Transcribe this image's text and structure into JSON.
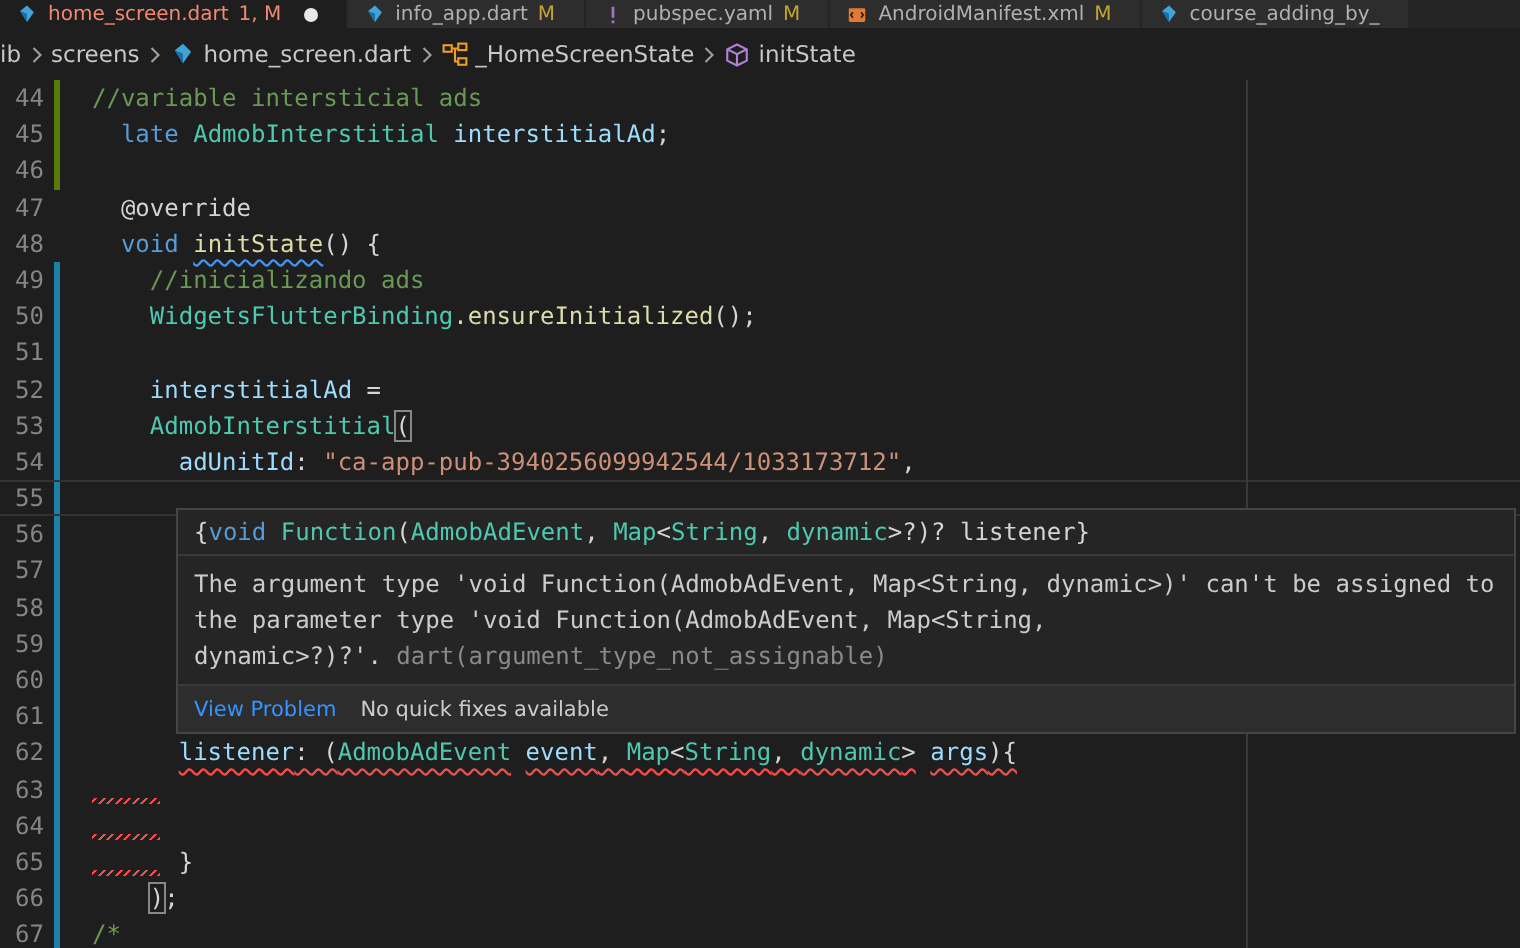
{
  "tabs": [
    {
      "label": "home_screen.dart",
      "badge": "1, M",
      "kind": "dart",
      "selected": true,
      "dirty": true
    },
    {
      "label": "info_app.dart",
      "badge": "M",
      "kind": "dart",
      "selected": false,
      "dirty": false
    },
    {
      "label": "pubspec.yaml",
      "badge": "M",
      "kind": "yaml",
      "selected": false,
      "dirty": false
    },
    {
      "label": "AndroidManifest.xml",
      "badge": "M",
      "kind": "xml",
      "selected": false,
      "dirty": false
    },
    {
      "label": "course_adding_by_",
      "kind": "dart",
      "selected": false,
      "dirty": false
    }
  ],
  "breadcrumb": [
    {
      "label": "ib",
      "kind": "folder"
    },
    {
      "label": "screens",
      "kind": "folder"
    },
    {
      "label": "home_screen.dart",
      "kind": "dart"
    },
    {
      "label": "_HomeScreenState",
      "kind": "class"
    },
    {
      "label": "initState",
      "kind": "method"
    }
  ],
  "lines": [
    {
      "number": "44",
      "kind": "added",
      "tokens": [
        {
          "kind": "comment",
          "text": "//variable intersticial ads"
        }
      ]
    },
    {
      "number": "45",
      "kind": "added",
      "tokens": [
        {
          "kind": "keyword",
          "text": "  late"
        },
        {
          "kind": "type",
          "text": " AdmobInterstitial"
        },
        {
          "kind": "variable",
          "text": " interstitialAd"
        },
        {
          "kind": "plain",
          "text": ";"
        }
      ]
    },
    {
      "number": "46",
      "kind": "added"
    },
    {
      "number": "47",
      "kind": "plain",
      "tokens": [
        {
          "kind": "plain",
          "text": "  @override"
        }
      ]
    },
    {
      "number": "48",
      "kind": "plain",
      "tokens": [
        {
          "kind": "keyword",
          "text": "  void"
        },
        {
          "kind": "function",
          "text": " initState",
          "warning": true
        },
        {
          "kind": "plain",
          "text": "() {"
        }
      ]
    },
    {
      "number": "49",
      "kind": "modified",
      "tokens": [
        {
          "kind": "comment",
          "text": "    //inicializando ads"
        }
      ]
    },
    {
      "number": "50",
      "kind": "modified",
      "tokens": [
        {
          "kind": "type",
          "text": "    WidgetsFlutterBinding"
        },
        {
          "kind": "function",
          "text": ".ensureInitialized"
        },
        {
          "kind": "plain",
          "text": "();"
        }
      ]
    },
    {
      "number": "51",
      "kind": "modified"
    },
    {
      "number": "52",
      "kind": "modified",
      "tokens": [
        {
          "kind": "variable",
          "text": "    interstitialAd"
        },
        {
          "kind": "plain",
          "text": " ="
        }
      ]
    },
    {
      "number": "53",
      "kind": "modified",
      "tokens": [
        {
          "kind": "type",
          "text": "    AdmobInterstitial"
        },
        {
          "kind": "plain",
          "text": "(",
          "bracket_match": true
        }
      ]
    },
    {
      "number": "54",
      "kind": "modified",
      "tokens": [
        {
          "kind": "variable",
          "text": "      adUnitId"
        },
        {
          "kind": "plain",
          "text": ": "
        },
        {
          "kind": "string",
          "text": "\"ca-app-pub-3940256099942544/1033173712\""
        },
        {
          "kind": "plain",
          "text": ","
        }
      ]
    },
    {
      "number": "55",
      "kind": "modified",
      "current": true
    },
    {
      "number": "56",
      "kind": "modified"
    },
    {
      "number": "57",
      "kind": "modified"
    },
    {
      "number": "58",
      "kind": "modified"
    },
    {
      "number": "59",
      "kind": "modified"
    },
    {
      "number": "60",
      "kind": "modified"
    },
    {
      "number": "61",
      "kind": "modified"
    },
    {
      "number": "62",
      "kind": "modified",
      "tokens": [
        {
          "kind": "variable",
          "text": "      listener",
          "error": true
        },
        {
          "kind": "plain",
          "text": ": (",
          "error": true
        },
        {
          "kind": "type",
          "text": "AdmobAdEvent",
          "error": true
        },
        {
          "kind": "variable",
          "text": " event",
          "error": true
        },
        {
          "kind": "plain",
          "text": ", ",
          "error": true
        },
        {
          "kind": "type",
          "text": "Map",
          "error": true
        },
        {
          "kind": "plain",
          "text": "<",
          "error": true
        },
        {
          "kind": "type",
          "text": "String",
          "error": true
        },
        {
          "kind": "plain",
          "text": ", ",
          "error": true
        },
        {
          "kind": "type",
          "text": "dynamic",
          "error": true
        },
        {
          "kind": "plain",
          "text": ">",
          "error": true
        },
        {
          "kind": "variable",
          "text": " args",
          "error": true
        },
        {
          "kind": "plain",
          "text": "){",
          "error": true
        }
      ]
    },
    {
      "number": "63",
      "kind": "modified",
      "gutter_error": true
    },
    {
      "number": "64",
      "kind": "modified",
      "gutter_error": true
    },
    {
      "number": "65",
      "kind": "modified",
      "gutter_error": true,
      "tokens": [
        {
          "kind": "plain",
          "text": "      }"
        }
      ]
    },
    {
      "number": "66",
      "kind": "modified",
      "tokens": [
        {
          "kind": "plain",
          "text": "    )",
          "bracket_match": true
        },
        {
          "kind": "plain",
          "text": ";"
        }
      ]
    },
    {
      "number": "67",
      "kind": "modified",
      "tokens": [
        {
          "kind": "comment",
          "text": "/*"
        }
      ]
    }
  ],
  "hover": {
    "signature": [
      {
        "kind": "plain",
        "text": "{"
      },
      {
        "kind": "keyword",
        "text": "void"
      },
      {
        "kind": "type",
        "text": " Function"
      },
      {
        "kind": "plain",
        "text": "("
      },
      {
        "kind": "type",
        "text": "AdmobAdEvent"
      },
      {
        "kind": "plain",
        "text": ", "
      },
      {
        "kind": "type",
        "text": "Map"
      },
      {
        "kind": "plain",
        "text": "<"
      },
      {
        "kind": "type",
        "text": "String"
      },
      {
        "kind": "plain",
        "text": ", "
      },
      {
        "kind": "type",
        "text": "dynamic"
      },
      {
        "kind": "plain",
        "text": ">?)? listener}"
      }
    ],
    "message": "The argument type 'void Function(AdmobAdEvent, Map<String, dynamic>)' can't be assigned to\nthe parameter type 'void Function(AdmobAdEvent, Map<String,\ndynamic>?)?'.",
    "source": "dart(argument_type_not_assignable)",
    "link": "View Problem",
    "note": "No quick fixes available"
  }
}
